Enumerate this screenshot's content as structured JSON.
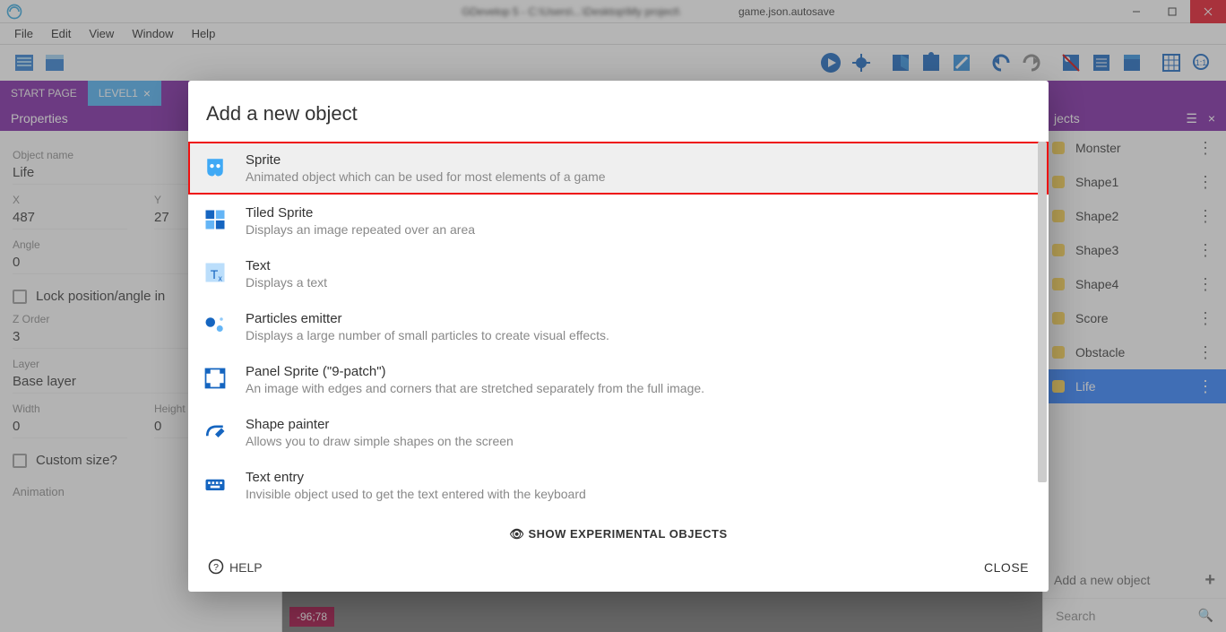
{
  "titlebar": {
    "suffix": "game.json.autosave"
  },
  "menu": {
    "file": "File",
    "edit": "Edit",
    "view": "View",
    "window": "Window",
    "help": "Help"
  },
  "tabs": {
    "start": "START PAGE",
    "level": "LEVEL1"
  },
  "properties": {
    "header": "Properties",
    "object_name_label": "Object name",
    "object_name": "Life",
    "x_label": "X",
    "x": "487",
    "y_label": "Y",
    "y": "27",
    "angle_label": "Angle",
    "angle": "0",
    "lock_label": "Lock position/angle in",
    "zorder_label": "Z Order",
    "zorder": "3",
    "layer_label": "Layer",
    "layer": "Base layer",
    "width_label": "Width",
    "width": "0",
    "height_label": "Height",
    "height": "0",
    "custom_size_label": "Custom size?",
    "animation_label": "Animation"
  },
  "canvas": {
    "coords": "-96;78"
  },
  "objects_panel": {
    "header": "jects",
    "items": [
      {
        "name": "Monster"
      },
      {
        "name": "Shape1"
      },
      {
        "name": "Shape2"
      },
      {
        "name": "Shape3"
      },
      {
        "name": "Shape4"
      },
      {
        "name": "Score"
      },
      {
        "name": "Obstacle"
      },
      {
        "name": "Life",
        "selected": true
      }
    ],
    "add_label": "Add a new object",
    "search_placeholder": "Search"
  },
  "dialog": {
    "title": "Add a new object",
    "options": [
      {
        "title": "Sprite",
        "desc": "Animated object which can be used for most elements of a game",
        "selected": true
      },
      {
        "title": "Tiled Sprite",
        "desc": "Displays an image repeated over an area"
      },
      {
        "title": "Text",
        "desc": "Displays a text"
      },
      {
        "title": "Particles emitter",
        "desc": "Displays a large number of small particles to create visual effects."
      },
      {
        "title": "Panel Sprite (\"9-patch\")",
        "desc": "An image with edges and corners that are stretched separately from the full image."
      },
      {
        "title": "Shape painter",
        "desc": "Allows you to draw simple shapes on the screen"
      },
      {
        "title": "Text entry",
        "desc": "Invisible object used to get the text entered with the keyboard"
      }
    ],
    "show_experimental": "SHOW EXPERIMENTAL OBJECTS",
    "help": "HELP",
    "close": "CLOSE"
  }
}
